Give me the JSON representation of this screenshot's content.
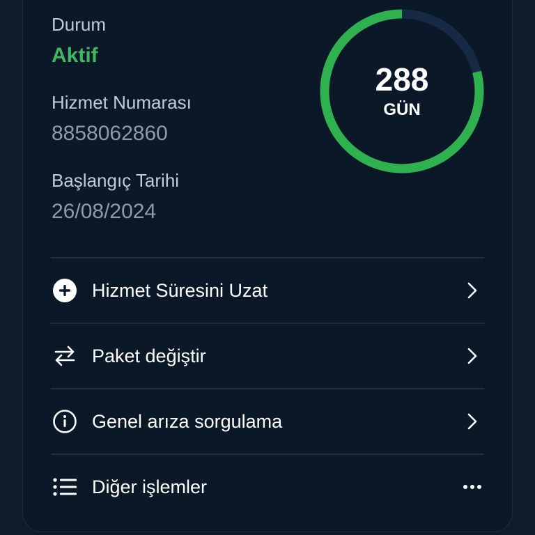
{
  "service": {
    "status_label": "Durum",
    "status_value": "Aktif",
    "number_label": "Hizmet Numarası",
    "number_value": "8858062860",
    "start_label": "Başlangıç Tarihi",
    "start_value": "26/08/2024"
  },
  "remaining": {
    "days": "288",
    "unit": "GÜN",
    "progress": 0.79,
    "color_fill": "#2fb150",
    "color_track": "#172a45"
  },
  "actions": [
    {
      "label": "Hizmet Süresini Uzat",
      "icon": "plus-circle-icon",
      "trail": "chevron-right-icon"
    },
    {
      "label": "Paket değiştir",
      "icon": "swap-arrows-icon",
      "trail": "chevron-right-icon"
    },
    {
      "label": "Genel arıza sorgulama",
      "icon": "info-circle-icon",
      "trail": "chevron-right-icon"
    },
    {
      "label": "Diğer işlemler",
      "icon": "list-icon",
      "trail": "more-dots-icon"
    }
  ],
  "colors": {
    "background": "#0e1b2a",
    "card": "#0b1828",
    "accent_green": "#3fb760",
    "text_primary": "#ffffff",
    "text_secondary": "#8f9aa8"
  }
}
